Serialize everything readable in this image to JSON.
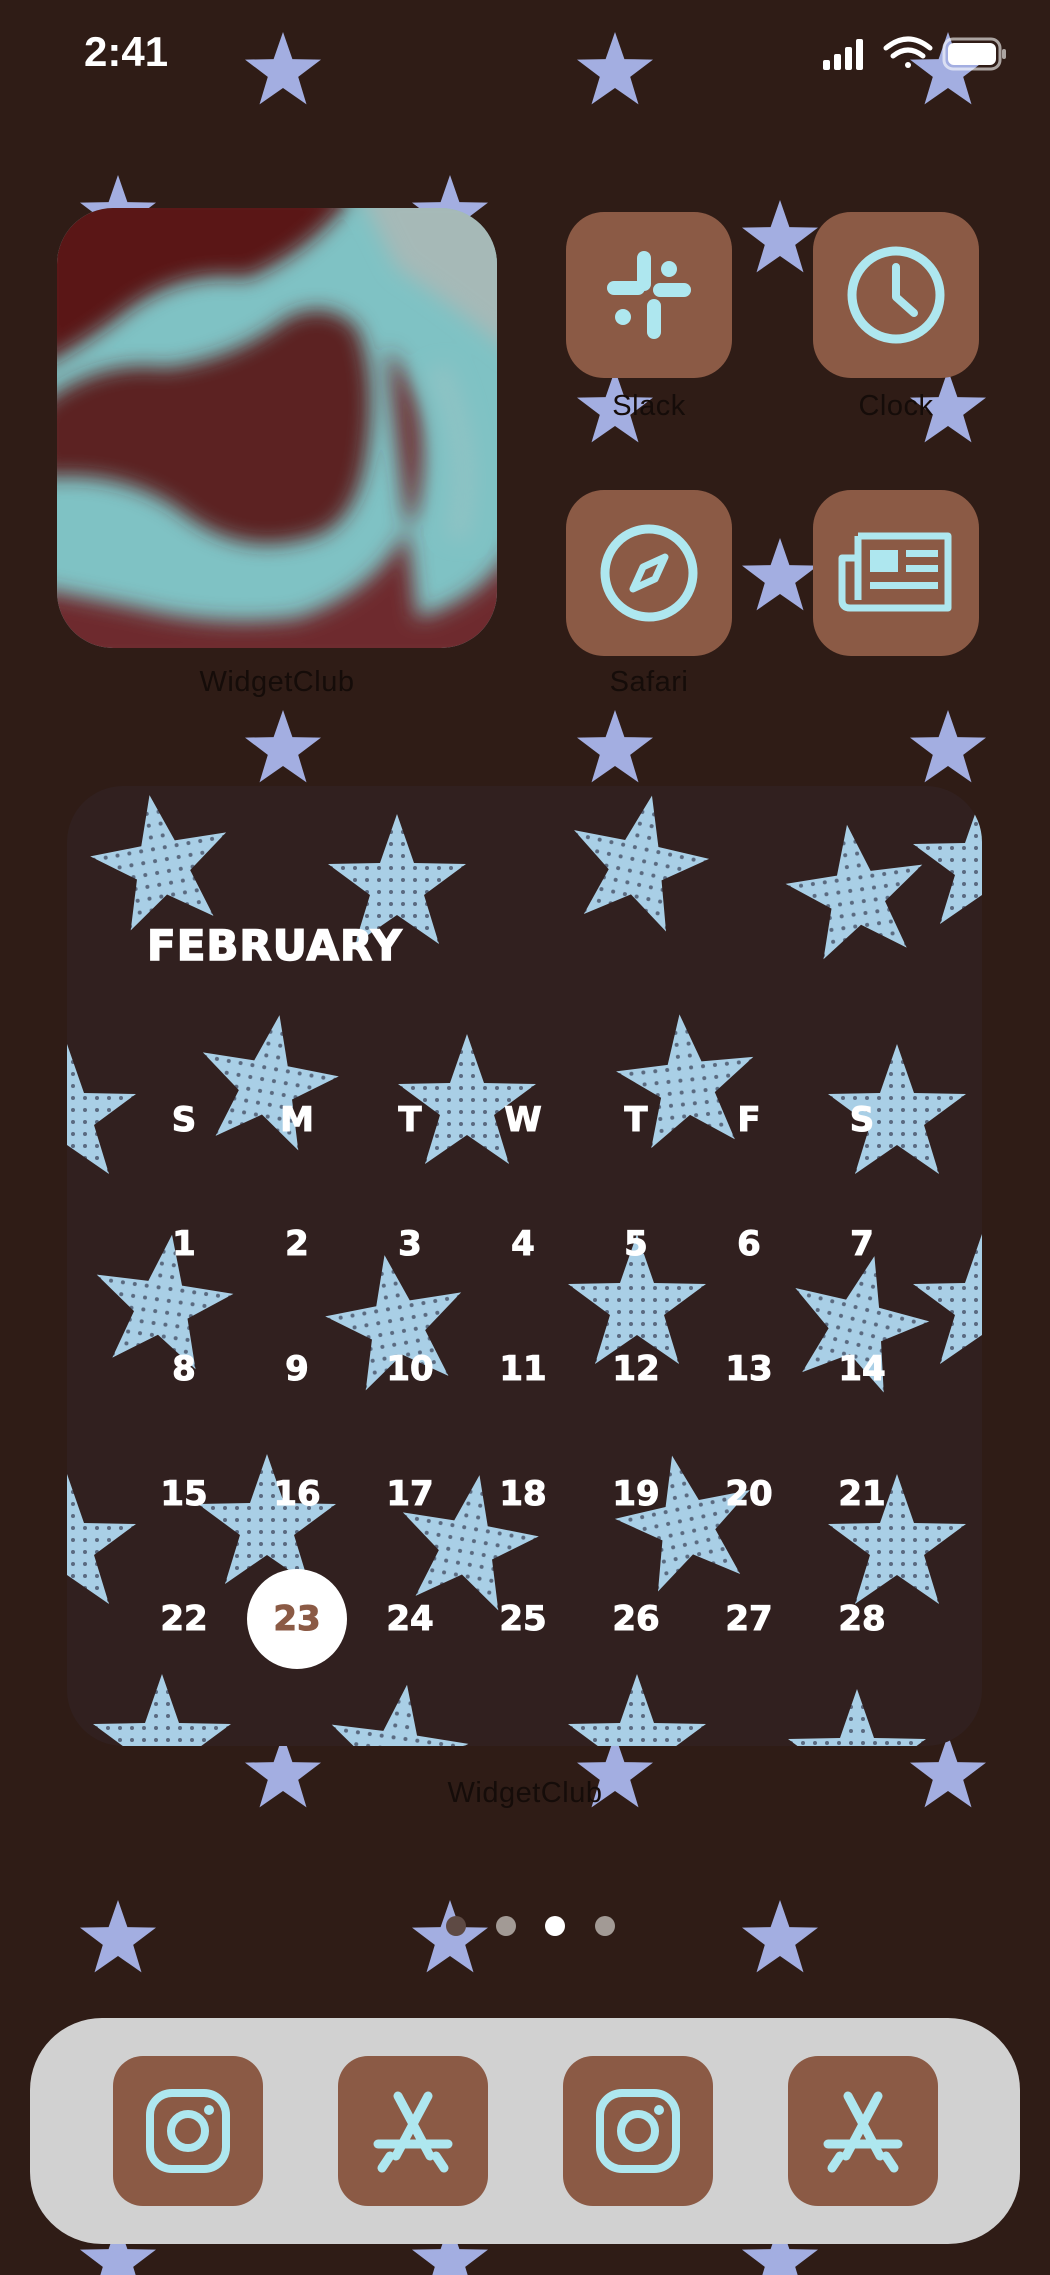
{
  "status_bar": {
    "time": "2:41"
  },
  "widgets": {
    "photo": {
      "label": "WidgetClub"
    },
    "calendar": {
      "month": "FEBRUARY",
      "weekdays": [
        "S",
        "M",
        "T",
        "W",
        "T",
        "F",
        "S"
      ],
      "weeks": [
        [
          "1",
          "2",
          "3",
          "4",
          "5",
          "6",
          "7"
        ],
        [
          "8",
          "9",
          "10",
          "11",
          "12",
          "13",
          "14"
        ],
        [
          "15",
          "16",
          "17",
          "18",
          "19",
          "20",
          "21"
        ],
        [
          "22",
          "23",
          "24",
          "25",
          "26",
          "27",
          "28"
        ]
      ],
      "today": "23",
      "label": "WidgetClub"
    }
  },
  "apps": [
    {
      "label": "Slack",
      "icon": "slack-icon"
    },
    {
      "label": "Clock",
      "icon": "clock-icon"
    },
    {
      "label": "Safari",
      "icon": "compass-icon"
    },
    {
      "label": "",
      "icon": "news-icon"
    }
  ],
  "dock": [
    {
      "icon": "instagram-icon"
    },
    {
      "icon": "app-store-icon"
    },
    {
      "icon": "instagram-icon"
    },
    {
      "icon": "app-store-icon"
    }
  ],
  "page_indicator": {
    "pages": 4,
    "current": 3
  },
  "colors": {
    "background": "#2f1c16",
    "app_tile": "#8b5a45",
    "icon_glyph": "#aee7ef",
    "star": "#a3aee1",
    "dock": "#d1d1d1"
  }
}
